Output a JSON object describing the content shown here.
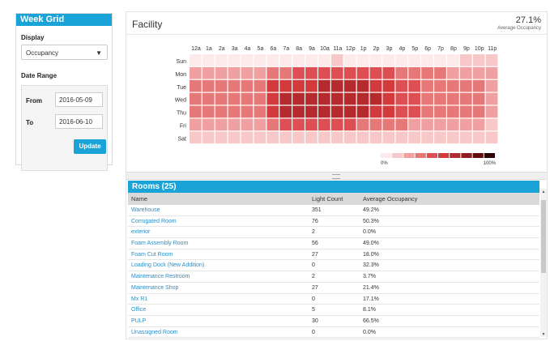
{
  "week_grid": {
    "title": "Week Grid",
    "display_label": "Display",
    "display_value": "Occupancy",
    "date_range_label": "Date Range",
    "from_label": "From",
    "from_value": "2016-05-09",
    "to_label": "To",
    "to_value": "2016-06-10",
    "update_label": "Update"
  },
  "facility": {
    "title": "Facility",
    "avg_value": "27.1%",
    "avg_label": "Average Occupancy"
  },
  "chart_data": {
    "type": "heatmap",
    "x_labels": [
      "12a",
      "1a",
      "2a",
      "3a",
      "4a",
      "5a",
      "6a",
      "7a",
      "8a",
      "9a",
      "10a",
      "11a",
      "12p",
      "1p",
      "2p",
      "3p",
      "4p",
      "5p",
      "6p",
      "7p",
      "8p",
      "9p",
      "10p",
      "11p"
    ],
    "y_labels": [
      "Sun",
      "Mon",
      "Tue",
      "Wed",
      "Thu",
      "Fri",
      "Sat"
    ],
    "values": [
      [
        8,
        8,
        8,
        8,
        8,
        8,
        8,
        8,
        8,
        8,
        8,
        10,
        8,
        8,
        8,
        8,
        8,
        8,
        8,
        8,
        8,
        12,
        15,
        10
      ],
      [
        25,
        25,
        25,
        25,
        25,
        25,
        30,
        35,
        40,
        40,
        45,
        45,
        45,
        45,
        40,
        40,
        35,
        30,
        30,
        30,
        25,
        25,
        25,
        20
      ],
      [
        30,
        30,
        30,
        30,
        30,
        35,
        50,
        55,
        55,
        55,
        60,
        60,
        60,
        60,
        55,
        50,
        45,
        40,
        35,
        35,
        30,
        30,
        30,
        25
      ],
      [
        30,
        30,
        30,
        30,
        30,
        35,
        55,
        60,
        60,
        60,
        65,
        65,
        65,
        65,
        60,
        55,
        45,
        40,
        35,
        35,
        30,
        30,
        30,
        25
      ],
      [
        30,
        30,
        30,
        30,
        30,
        35,
        55,
        60,
        60,
        60,
        65,
        65,
        65,
        60,
        55,
        55,
        45,
        40,
        35,
        35,
        30,
        30,
        30,
        25
      ],
      [
        22,
        22,
        22,
        22,
        22,
        22,
        35,
        40,
        40,
        40,
        40,
        40,
        40,
        38,
        35,
        35,
        30,
        28,
        25,
        25,
        22,
        22,
        22,
        18
      ],
      [
        12,
        12,
        12,
        12,
        12,
        12,
        15,
        15,
        15,
        15,
        15,
        15,
        15,
        15,
        15,
        15,
        15,
        15,
        12,
        12,
        12,
        12,
        12,
        10
      ]
    ],
    "legend_min_label": "0%",
    "legend_max_label": "100%",
    "color_scale": [
      "#fdeaea",
      "#f8c8c8",
      "#f0a0a0",
      "#e67878",
      "#dd4f52",
      "#d23a3c",
      "#b52a2c",
      "#8f1c1e",
      "#5e0f10",
      "#2b0505"
    ]
  },
  "rooms": {
    "title": "Rooms (25)",
    "columns": [
      "Name",
      "Light Count",
      "Average Occupancy"
    ],
    "rows": [
      [
        "Warehouse",
        "351",
        "49.2%"
      ],
      [
        "Corrugated Room",
        "76",
        "50.3%"
      ],
      [
        "exterior",
        "2",
        "0.0%"
      ],
      [
        "Foam Assembly Room",
        "56",
        "49.0%"
      ],
      [
        "Foam Cut Room",
        "27",
        "18.0%"
      ],
      [
        "Loading Dock (New Addition)",
        "0",
        "32.3%"
      ],
      [
        "Maintenance Restroom",
        "2",
        "3.7%"
      ],
      [
        "Maintenance Shop",
        "27",
        "21.4%"
      ],
      [
        "Mx R1",
        "0",
        "17.1%"
      ],
      [
        "Office",
        "5",
        "8.1%"
      ],
      [
        "PULP",
        "30",
        "66.5%"
      ],
      [
        "Unassigned Room",
        "0",
        "0.0%"
      ]
    ]
  }
}
